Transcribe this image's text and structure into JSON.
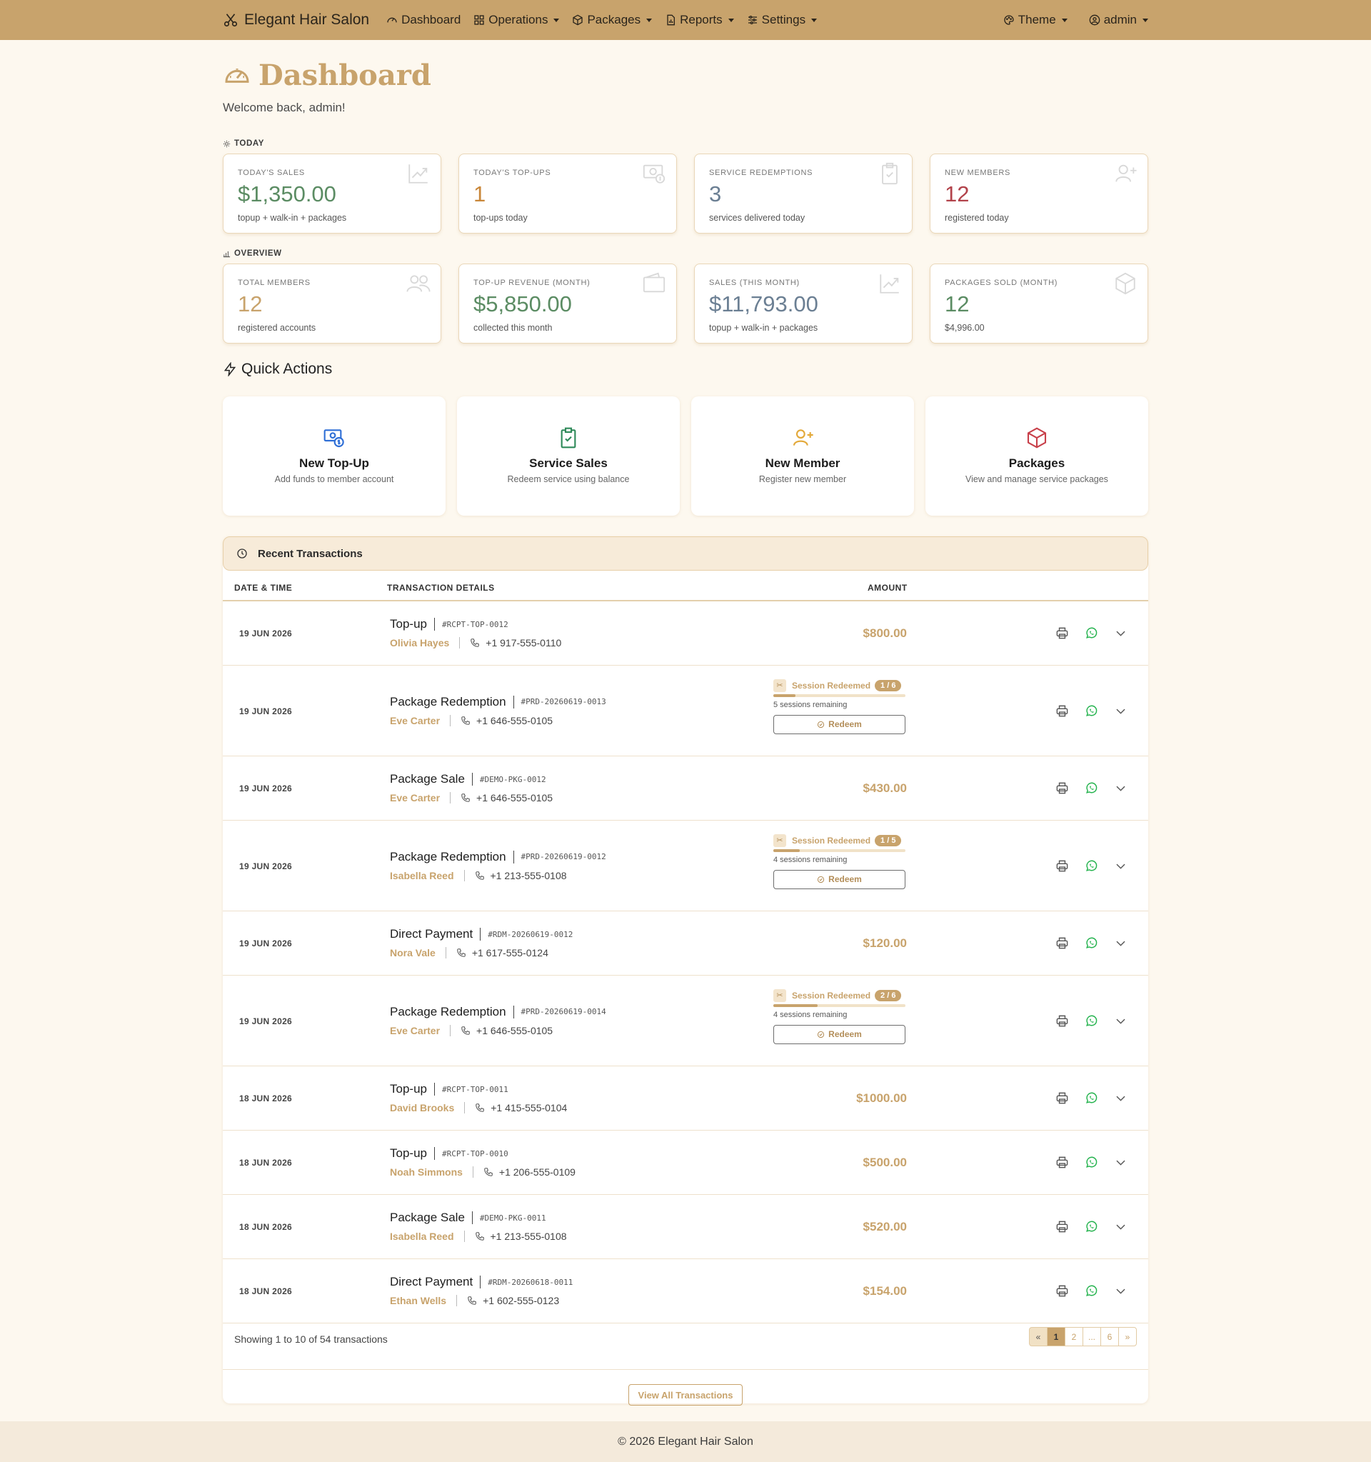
{
  "nav": {
    "brand": "Elegant Hair Salon",
    "items": [
      {
        "label": "Dashboard",
        "icon": "gauge-icon",
        "dropdown": false
      },
      {
        "label": "Operations",
        "icon": "grid-icon",
        "dropdown": true
      },
      {
        "label": "Packages",
        "icon": "box-icon",
        "dropdown": true
      },
      {
        "label": "Reports",
        "icon": "report-icon",
        "dropdown": true
      },
      {
        "label": "Settings",
        "icon": "sliders-icon",
        "dropdown": true
      }
    ],
    "theme": "Theme",
    "user": "admin"
  },
  "page": {
    "title": "Dashboard",
    "welcome": "Welcome back, admin!"
  },
  "today": {
    "label": "TODAY",
    "cards": [
      {
        "title": "TODAY'S SALES",
        "value": "$1,350.00",
        "sub": "topup + walk-in + packages",
        "color": "#5b8c63",
        "icon": "trend-icon"
      },
      {
        "title": "TODAY'S TOP-UPS",
        "value": "1",
        "sub": "top-ups today",
        "color": "#c9873a",
        "icon": "cash-icon"
      },
      {
        "title": "SERVICE REDEMPTIONS",
        "value": "3",
        "sub": "services delivered today",
        "color": "#6b7f93",
        "icon": "clipboard-check-icon"
      },
      {
        "title": "NEW MEMBERS",
        "value": "12",
        "sub": "registered today",
        "color": "#b2434b",
        "icon": "person-plus-icon"
      }
    ]
  },
  "overview": {
    "label": "OVERVIEW",
    "cards": [
      {
        "title": "TOTAL MEMBERS",
        "value": "12",
        "sub": "registered accounts",
        "color": "#c8a36c",
        "icon": "people-icon"
      },
      {
        "title": "TOP-UP REVENUE (MONTH)",
        "value": "$5,850.00",
        "sub": "collected this month",
        "color": "#5b8c63",
        "icon": "wallet-icon"
      },
      {
        "title": "SALES (THIS MONTH)",
        "value": "$11,793.00",
        "sub": "topup + walk-in + packages",
        "color": "#6b7f93",
        "icon": "trend-icon"
      },
      {
        "title": "PACKAGES SOLD (MONTH)",
        "value": "12",
        "sub": "$4,996.00",
        "color": "#5b8c63",
        "icon": "box-icon"
      }
    ]
  },
  "quick_actions": {
    "title": "Quick Actions",
    "items": [
      {
        "name": "New Top-Up",
        "desc": "Add funds to member account",
        "color": "#2f6fd6",
        "icon": "cash-icon"
      },
      {
        "name": "Service Sales",
        "desc": "Redeem service using balance",
        "color": "#2f8a5a",
        "icon": "clipboard-check-icon"
      },
      {
        "name": "New Member",
        "desc": "Register new member",
        "color": "#e3a93a",
        "icon": "person-plus-icon"
      },
      {
        "name": "Packages",
        "desc": "View and manage service packages",
        "color": "#c8404a",
        "icon": "box-icon"
      }
    ]
  },
  "transactions": {
    "title": "Recent Transactions",
    "columns": [
      "DATE & TIME",
      "TRANSACTION DETAILS",
      "AMOUNT"
    ],
    "rows": [
      {
        "date": "19 JUN 2026",
        "type": "Top-up",
        "ref": "#RCPT-TOP-0012",
        "name": "Olivia Hayes",
        "phone": "+1 917-555-0110",
        "amount": "$800.00"
      },
      {
        "date": "19 JUN 2026",
        "type": "Package Redemption",
        "ref": "#PRD-20260619-0013",
        "name": "Eve Carter",
        "phone": "+1 646-555-0105",
        "redeem": {
          "label": "Session Redeemed",
          "badge": "1 / 6",
          "progress": 0.167,
          "remaining": "5 sessions remaining",
          "button": "Redeem"
        }
      },
      {
        "date": "19 JUN 2026",
        "type": "Package Sale",
        "ref": "#DEMO-PKG-0012",
        "name": "Eve Carter",
        "phone": "+1 646-555-0105",
        "amount": "$430.00"
      },
      {
        "date": "19 JUN 2026",
        "type": "Package Redemption",
        "ref": "#PRD-20260619-0012",
        "name": "Isabella Reed",
        "phone": "+1 213-555-0108",
        "redeem": {
          "label": "Session Redeemed",
          "badge": "1 / 5",
          "progress": 0.2,
          "remaining": "4 sessions remaining",
          "button": "Redeem"
        }
      },
      {
        "date": "19 JUN 2026",
        "type": "Direct Payment",
        "ref": "#RDM-20260619-0012",
        "name": "Nora Vale",
        "phone": "+1 617-555-0124",
        "amount": "$120.00"
      },
      {
        "date": "19 JUN 2026",
        "type": "Package Redemption",
        "ref": "#PRD-20260619-0014",
        "name": "Eve Carter",
        "phone": "+1 646-555-0105",
        "redeem": {
          "label": "Session Redeemed",
          "badge": "2 / 6",
          "progress": 0.333,
          "remaining": "4 sessions remaining",
          "button": "Redeem"
        }
      },
      {
        "date": "18 JUN 2026",
        "type": "Top-up",
        "ref": "#RCPT-TOP-0011",
        "name": "David Brooks",
        "phone": "+1 415-555-0104",
        "amount": "$1000.00"
      },
      {
        "date": "18 JUN 2026",
        "type": "Top-up",
        "ref": "#RCPT-TOP-0010",
        "name": "Noah Simmons",
        "phone": "+1 206-555-0109",
        "amount": "$500.00"
      },
      {
        "date": "18 JUN 2026",
        "type": "Package Sale",
        "ref": "#DEMO-PKG-0011",
        "name": "Isabella Reed",
        "phone": "+1 213-555-0108",
        "amount": "$520.00"
      },
      {
        "date": "18 JUN 2026",
        "type": "Direct Payment",
        "ref": "#RDM-20260618-0011",
        "name": "Ethan Wells",
        "phone": "+1 602-555-0123",
        "amount": "$154.00"
      }
    ],
    "showing": "Showing 1 to 10 of 54 transactions",
    "pager": [
      "«",
      "1",
      "2",
      "...",
      "6",
      "»"
    ],
    "view_all": "View All Transactions"
  },
  "footer": "© 2026 Elegant Hair Salon"
}
